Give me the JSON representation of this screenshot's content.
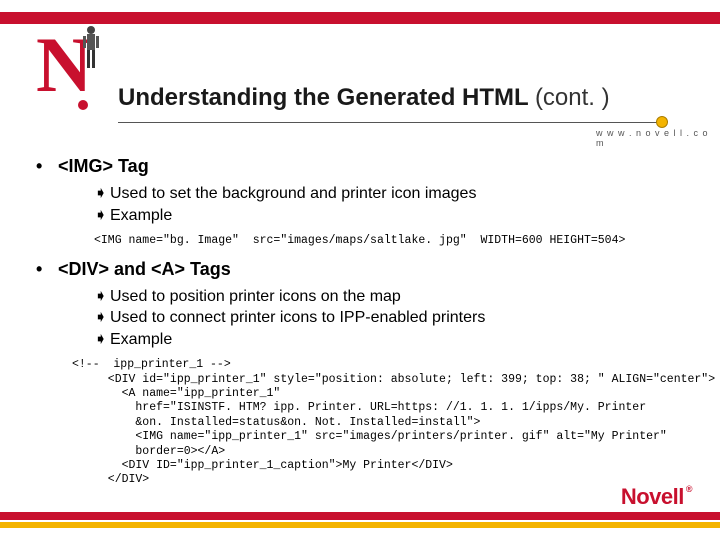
{
  "header": {
    "title_main": "Understanding the Generated HTML ",
    "title_cont": "(cont. )",
    "domain": "w w w . n o v e l l . c o m"
  },
  "content": {
    "section1": {
      "heading": "<IMG> Tag",
      "b1": "Used to set the background and printer icon images",
      "b2": "Example",
      "code": "<IMG name=\"bg. Image\"  src=\"images/maps/saltlake. jpg\"  WIDTH=600 HEIGHT=504>"
    },
    "section2": {
      "heading": "<DIV> and <A> Tags",
      "b1": "Used to position printer icons on the map",
      "b2": "Used to connect printer icons to IPP-enabled printers",
      "b3": "Example",
      "code_top": "<!--  ipp_printer_1 -->",
      "code_body": "  <DIV id=\"ipp_printer_1\" style=\"position: absolute; left: 399; top: 38; \" ALIGN=\"center\">\n    <A name=\"ipp_printer_1\"\n      href=\"ISINSTF. HTM? ipp. Printer. URL=https: //1. 1. 1. 1/ipps/My. Printer\n      &on. Installed=status&on. Not. Installed=install\">\n      <IMG name=\"ipp_printer_1\" src=\"images/printers/printer. gif\" alt=\"My Printer\"\n      border=0></A>\n    <DIV ID=\"ipp_printer_1_caption\">My Printer</DIV>\n  </DIV>"
    }
  },
  "footer": {
    "logo": "Novell",
    "tm": "®"
  }
}
